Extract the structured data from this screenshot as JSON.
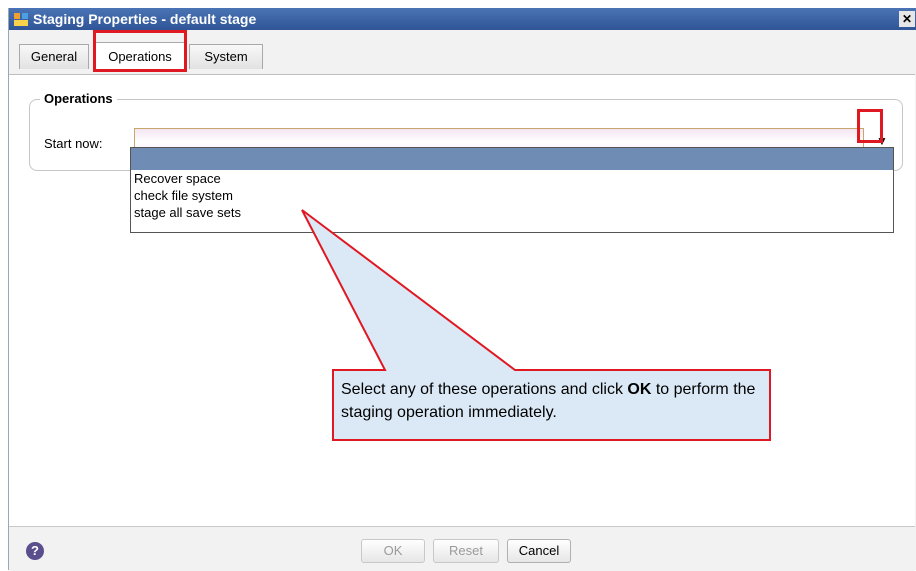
{
  "window": {
    "title": "Staging Properties - default stage",
    "close_label": "✕"
  },
  "tabs": [
    {
      "label": "General"
    },
    {
      "label": "Operations"
    },
    {
      "label": "System"
    }
  ],
  "operations": {
    "group_title": "Operations",
    "start_now_label": "Start now:",
    "start_now_value": "",
    "dropdown_options": [
      "",
      "Recover space",
      "check file system",
      "stage all save sets"
    ]
  },
  "callout": {
    "text_before": "Select any of these operations and click ",
    "text_bold": "OK",
    "text_after": " to perform the staging operation immediately."
  },
  "footer": {
    "help_label": "?",
    "ok_label": "OK",
    "reset_label": "Reset",
    "cancel_label": "Cancel"
  },
  "colors": {
    "highlight": "#e01822",
    "titlebar": "#2f5597",
    "selected_row": "#6f8db4",
    "callout_fill": "#dbe9f6"
  }
}
